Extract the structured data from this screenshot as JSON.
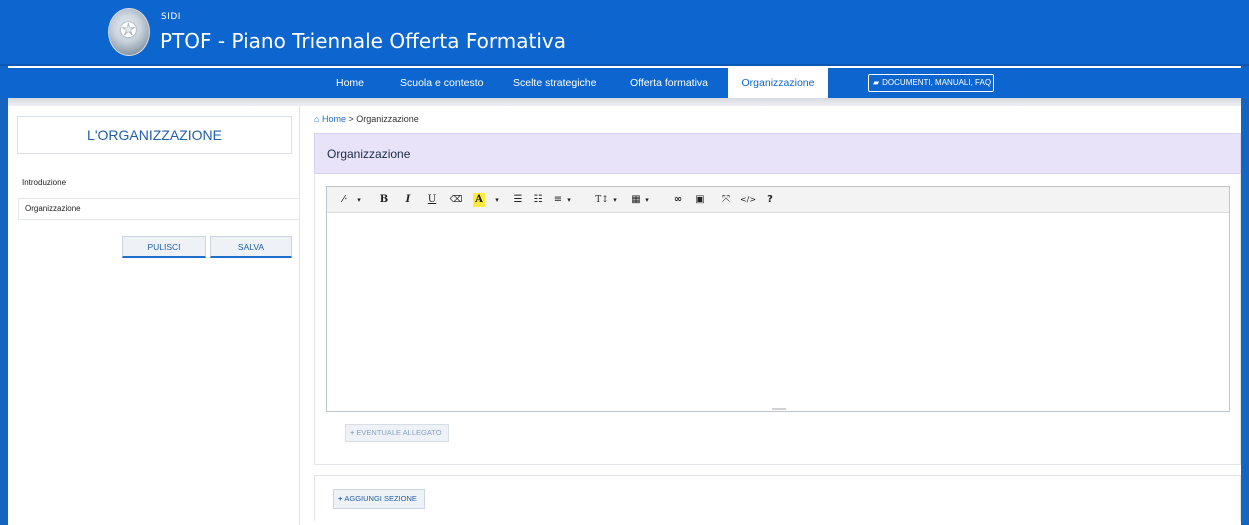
{
  "header": {
    "sidi_label": "SIDI",
    "app_title": "PTOF - Piano Triennale Offerta Formativa"
  },
  "nav": {
    "items": [
      {
        "label": "Home"
      },
      {
        "label": "Scuola e contesto"
      },
      {
        "label": "Scelte strategiche"
      },
      {
        "label": "Offerta formativa"
      },
      {
        "label": "Organizzazione",
        "active": true
      }
    ],
    "docs_label": "DOCUMENTI, MANUALI, FAQ"
  },
  "sidebar": {
    "title": "L'ORGANIZZAZIONE",
    "heading": "Introduzione",
    "items": [
      {
        "label": "Organizzazione"
      }
    ],
    "buttons": {
      "clear": "PULISCI",
      "save": "SALVA"
    }
  },
  "breadcrumb": {
    "home": "Home",
    "separator": ">",
    "current": "Organizzazione"
  },
  "panel": {
    "title": "Organizzazione"
  },
  "editor": {
    "content": "",
    "toolbar": [
      {
        "icon": "magic-wand-icon",
        "glyph": "⁄⋅",
        "dropdown": true
      },
      {
        "icon": "bold-icon",
        "glyph": "B"
      },
      {
        "icon": "italic-icon",
        "glyph": "I"
      },
      {
        "icon": "underline-icon",
        "glyph": "U"
      },
      {
        "icon": "eraser-icon",
        "glyph": "⌫"
      },
      {
        "icon": "highlight-color-icon",
        "glyph": "A",
        "dropdown": true
      },
      {
        "icon": "unordered-list-icon",
        "glyph": "☰"
      },
      {
        "icon": "ordered-list-icon",
        "glyph": "☷"
      },
      {
        "icon": "align-icon",
        "glyph": "≡",
        "dropdown": true
      },
      {
        "icon": "text-height-icon",
        "glyph": "T↕",
        "dropdown": true
      },
      {
        "icon": "table-icon",
        "glyph": "▦",
        "dropdown": true
      },
      {
        "icon": "link-icon",
        "glyph": "∞"
      },
      {
        "icon": "image-icon",
        "glyph": "▣"
      },
      {
        "icon": "fullscreen-icon",
        "glyph": "⤧"
      },
      {
        "icon": "code-view-icon",
        "glyph": "</>"
      },
      {
        "icon": "help-icon",
        "glyph": "?"
      }
    ]
  },
  "attachment_button": "EVENTUALE ALLEGATO",
  "add_section_button": "AGGIUNGI SEZIONE",
  "colors": {
    "brand_blue": "#0d66d0",
    "panel_lilac": "#e9e3fa",
    "highlight_yellow": "#ffeb3b"
  }
}
